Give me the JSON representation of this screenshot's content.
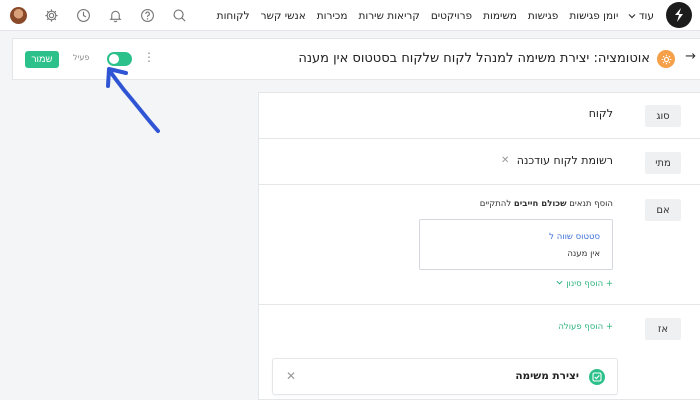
{
  "nav": {
    "items": [
      "לקוחות",
      "אנשי קשר",
      "מכירות",
      "קריאות שירות",
      "פרויקטים",
      "משימות",
      "פגישות",
      "יומן פגישות"
    ],
    "more_label": "עוד"
  },
  "header": {
    "title": "אוטומציה: יצירת משימה למנהל לקוח שלקוח בסטטוס אין מענה",
    "save_label": "שמור",
    "active_label": "פעיל",
    "toggle_on": true
  },
  "rows": {
    "type": {
      "tag": "סוג",
      "value": "לקוח"
    },
    "when": {
      "tag": "מתי",
      "value": "רשומת לקוח עודכנה"
    },
    "if": {
      "tag": "אם",
      "intro_prefix": "הוסף תנאים ",
      "intro_bold": "שכולם חייבים",
      "intro_suffix": " להתקיים",
      "condition_field": "סטטוס שווה ל",
      "condition_value": "אין מענה",
      "add_filter_label": "+ הוסף סינון"
    },
    "then": {
      "tag": "אז",
      "add_action_label": "+ הוסף פעולה"
    }
  },
  "action_card": {
    "label": "יצירת משימה"
  },
  "colors": {
    "accent": "#2cc08a",
    "link": "#3b6fd9",
    "annotation": "#2f55d4",
    "automation_icon": "#f6a04a"
  }
}
